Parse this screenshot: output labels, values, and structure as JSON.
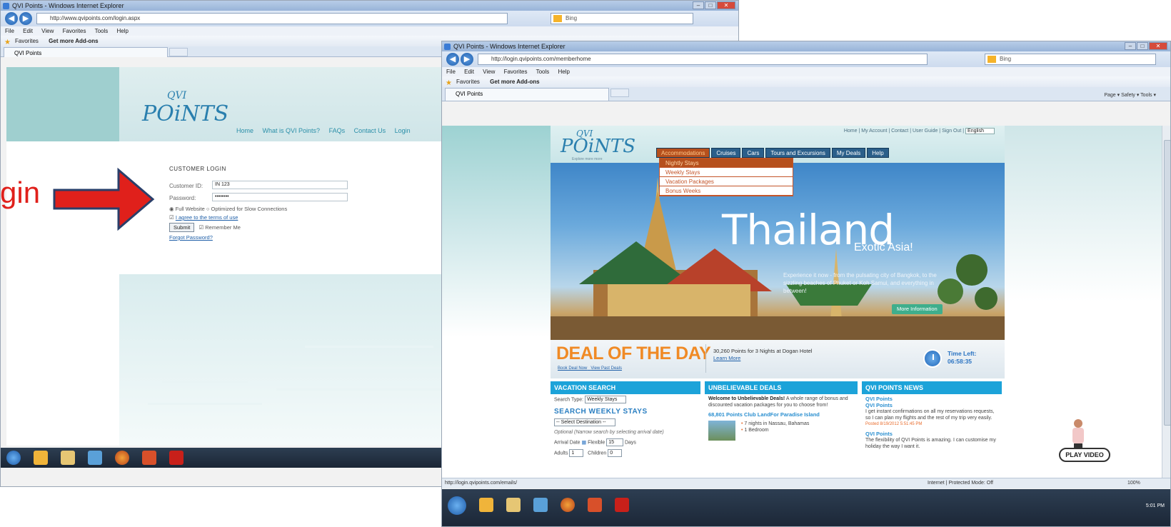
{
  "annotation": {
    "label": "gin"
  },
  "win1": {
    "title": "QVI Points - Windows Internet Explorer",
    "url": "http://www.qvipoints.com/login.aspx",
    "search_engine": "Bing",
    "menu": [
      "File",
      "Edit",
      "View",
      "Favorites",
      "Tools",
      "Help"
    ],
    "favorites_label": "Favorites",
    "addons_label": "Get more Add-ons",
    "tab_label": "QVI Points",
    "logo_top": "QVI",
    "logo_main": "POiNTS",
    "nav": [
      "Home",
      "What is QVI Points?",
      "FAQs",
      "Contact Us",
      "Login"
    ],
    "login": {
      "title": "CUSTOMER LOGIN",
      "customer_id_label": "Customer ID:",
      "customer_id_value": "IN 123",
      "password_label": "Password:",
      "password_value": "••••••••",
      "mode_full": "Full Website",
      "mode_slow": "Optimized for Slow Connections",
      "terms": "I agree to the terms of use",
      "submit": "Submit",
      "remember": "Remember Me",
      "forgot": "Forgot Password?"
    }
  },
  "win2": {
    "title": "QVI Points - Windows Internet Explorer",
    "url": "http://login.qvipoints.com/memberhome",
    "search_engine": "Bing",
    "menu": [
      "File",
      "Edit",
      "View",
      "Favorites",
      "Tools",
      "Help"
    ],
    "favorites_label": "Favorites",
    "addons_label": "Get more Add-ons",
    "tab_label": "QVI Points",
    "cmdbar": "Page ▾  Safety ▾  Tools ▾",
    "logo_top": "QVI",
    "logo_main": "POiNTS",
    "logo_tag": "Explore more more",
    "toplinks": "Home | My Account | Contact | User Guide | Sign Out |",
    "language": "English",
    "nav": [
      "Accommodations",
      "Cruises",
      "Cars",
      "Tours and Excursions",
      "My Deals",
      "Help"
    ],
    "dropdown": [
      "Nightly Stays",
      "Weekly Stays",
      "Vacation Packages",
      "Bonus Weeks"
    ],
    "hero": {
      "title": "Thailand",
      "subtitle": "Exotic Asia!",
      "desc": "Experience it now - from the pulsating city of Bangkok, to the sizzling beaches of Phuket or Koh Samui, and everything in between!",
      "button": "More Information"
    },
    "deal": {
      "title": "DEAL OF THE DAY",
      "link1": "Book Deal Now",
      "link2": "View Past Deals",
      "text": "30,260 Points for 3 Nights at Dogan Hotel",
      "learn": "Learn More",
      "time_label": "Time Left:",
      "time_value": "06:58:35"
    },
    "vacation": {
      "header": "VACATION SEARCH",
      "search_type_label": "Search Type:",
      "search_type_value": "Weekly Stays",
      "section": "SEARCH WEEKLY STAYS",
      "destination": "-- Select Destination --",
      "optional": "Optional (Narrow search by selecting arrival date)",
      "arrival_label": "Arrival Date",
      "flexible_label": "Flexible",
      "flexible_value": "15",
      "days_label": "Days",
      "adults_label": "Adults",
      "adults_value": "1",
      "children_label": "Children",
      "children_value": "0"
    },
    "deals": {
      "header": "UNBELIEVABLE DEALS",
      "intro_bold": "Welcome to Unbelievable Deals!",
      "intro": "A whole range of bonus and discounted vacation packages for you to choose from!",
      "offer_title": "68,801 Points Club LandFor Paradise Island",
      "offer_line1": "7 nights in Nassau, Bahamas",
      "offer_line2": "1 Bedroom"
    },
    "news": {
      "header": "QVI POINTS NEWS",
      "item1_title": "QVI Points",
      "item1_sub": "QVI Points",
      "item1_text": "I get instant confirmations on all my reservations requests, so I can plan my flights and the rest of my trip very easily.",
      "item1_meta": "Posted 8/19/2012 5:51:45 PM",
      "item2_title": "QVI Points",
      "item2_text": "The flexibility of QVI Points is amazing. I can customise my holiday the way I want it."
    },
    "status_url": "http://login.qvipoints.com/emails/",
    "status_zone": "Internet | Protected Mode: Off",
    "zoom": "100%",
    "clock_time": "5:01 PM"
  },
  "play_video": "PLAY VIDEO"
}
